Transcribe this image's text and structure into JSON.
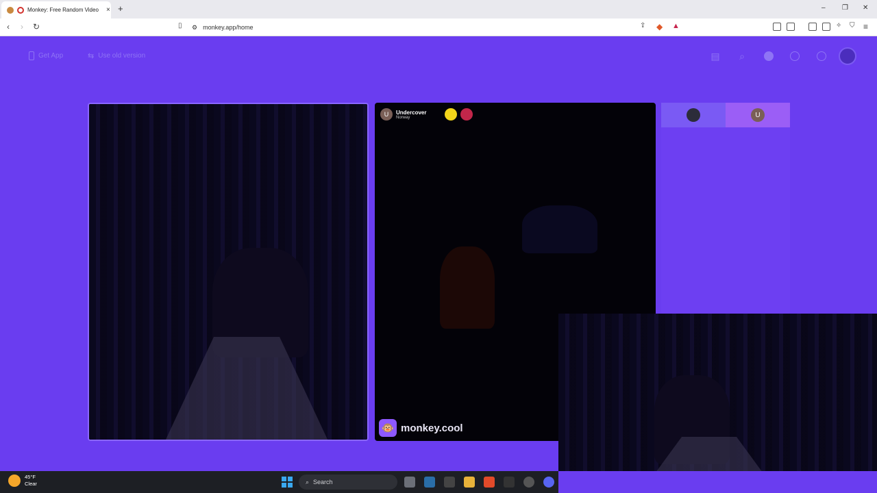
{
  "browser": {
    "tab_title": "Monkey: Free Random Video",
    "tab_close": "×",
    "new_tab": "+",
    "url": "monkey.app/home",
    "controls": {
      "minimize": "–",
      "restore": "❐",
      "close": "✕"
    }
  },
  "header": {
    "get_app": "Get App",
    "old_version": "Use old version"
  },
  "peer": {
    "initial": "U",
    "name": "Undercover",
    "country": "Norway"
  },
  "watermark": {
    "text": "monkey.cool",
    "logo": "🐵"
  },
  "side_panel": {
    "tab2_initial": "U"
  },
  "taskbar": {
    "temperature": "45°F",
    "condition": "Clear",
    "search_placeholder": "Search"
  },
  "colors": {
    "page_bg": "#6a3df0",
    "accent": "#8d58ff"
  }
}
